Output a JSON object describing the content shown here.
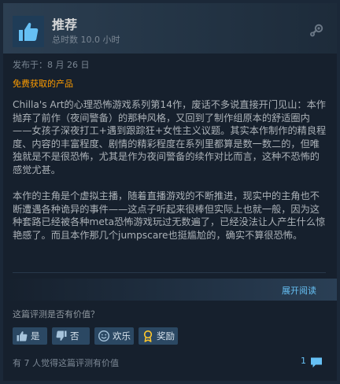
{
  "header": {
    "recommendation": "推荐",
    "hours": "总时数 10.0 小时"
  },
  "meta": {
    "posted": "发布于：8 月 26 日",
    "free_product": "免费获取的产品"
  },
  "review": {
    "paragraphs": [
      "Chilla's Art的心理恐怖游戏系列第14作，废话不多说直接开门见山：本作抛弃了前作（夜间警备）的那种风格，又回到了制作组原本的舒适圈内——女孩子深夜打工+遇到跟踪狂+女性主义议题。其实本作制作的精良程度、内容的丰富程度、剧情的精彩程度在系列里都算是数一数二的，但唯独就是不是很恐怖，尤其是作为夜间警备的续作对比而言，这种不恐怖的感觉尤甚。",
      "本作的主角是个虚拟主播，随着直播游戏的不断推进，现实中的主角也不断遭遇各种诡异的事件——这点子听起来很棒但实际上也就一般，因为这种套路已经被各种meta恐怖游戏玩过无数遍了，已经没法让人产生什么惊艳感了。而且本作那几个jumpscare也挺尴尬的，确实不算很恐怖。"
    ],
    "read_more": "展开阅读"
  },
  "feedback": {
    "question": "这篇评测是否有价值？",
    "yes": "是",
    "no": "否",
    "funny": "欢乐",
    "award": "奖励",
    "helpful_count": "有 7 人觉得这篇评测有价值",
    "comment_count": "1"
  },
  "colors": {
    "accent_link": "#66c0f4",
    "free_tag": "#ff9d00",
    "button_bg": "#2b4863"
  },
  "icons": {
    "recommendation": "thumbs-up-icon",
    "platform": "steam-icon",
    "yes": "thumbs-up-icon",
    "no": "thumbs-down-icon",
    "funny": "smiley-icon",
    "award": "award-icon",
    "comments": "comment-bubble-icon"
  }
}
